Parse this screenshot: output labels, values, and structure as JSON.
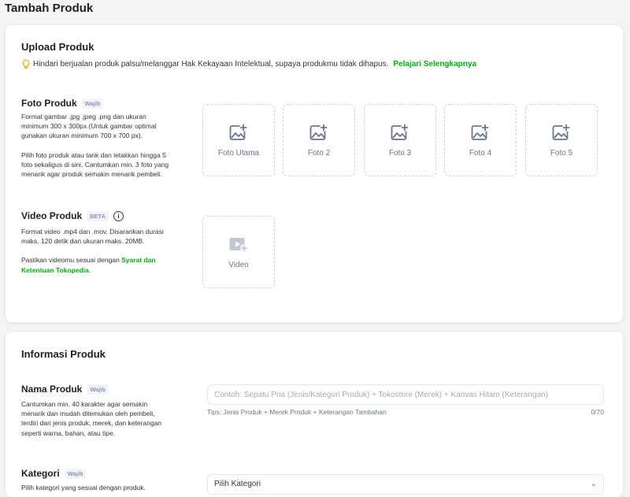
{
  "page": {
    "title": "Tambah Produk"
  },
  "upload": {
    "title": "Upload Produk",
    "notice": "Hindari berjualan produk palsu/melanggar Hak Kekayaan Intelektual, supaya produkmu tidak dihapus.",
    "notice_link": "Pelajari Selengkapnya",
    "accent_color": "#03ac0e",
    "foto": {
      "label": "Foto Produk",
      "badge": "Wajib",
      "desc1": "Format gambar .jpg .jpeg .png dan ukuran minimum 300 x 300px (Untuk gambar optimal gunakan ukuran minimum 700 x 700 px).",
      "desc2": "Pilih foto produk atau tarik dan letakkan hingga 5 foto sekaligus di sini. Cantumkan min. 3 foto yang menarik agar produk semakin menarik pembeli.",
      "slots": [
        "Foto Utama",
        "Foto 2",
        "Foto 3",
        "Foto 4",
        "Foto 5"
      ],
      "slot_icon": "image-add-icon"
    },
    "video": {
      "label": "Video Produk",
      "badge": "BETA",
      "info_icon": "info-icon",
      "desc1": "Format video .mp4 dan .mov. Disarankan durasi maks. 120 detik dan ukuran maks. 20MB.",
      "desc2_prefix": "Pastikan videomu sesuai dengan",
      "desc2_link": "Syarat dan Ketentuan Tokopedia",
      "desc2_suffix": ".",
      "slot": "Video",
      "slot_icon": "video-add-icon"
    }
  },
  "info": {
    "title": "Informasi Produk",
    "nama": {
      "label": "Nama Produk",
      "badge": "Wajib",
      "desc": "Cantumkan min. 40 karakter agar semakin menarik dan mudah ditemukan oleh pembeli, terdiri dari jenis produk, merek, dan keterangan seperti warna, bahan, atau tipe.",
      "value": "",
      "placeholder": "Contoh: Sepatu Pria (Jenis/Kategori Produk) + Tokostore (Merek) + Kanvas Hitam (Keterangan)",
      "hint": "Tips: Jenis Produk + Merek Produk + Keterangan Tambahan",
      "counter": "0/70"
    },
    "kategori": {
      "label": "Kategori",
      "badge": "Wajib",
      "desc": "Pilih kategori yang sesuai dengan produk.",
      "placeholder": "Pilih Kategori",
      "chevron_icon": "chevron-down-icon"
    }
  }
}
